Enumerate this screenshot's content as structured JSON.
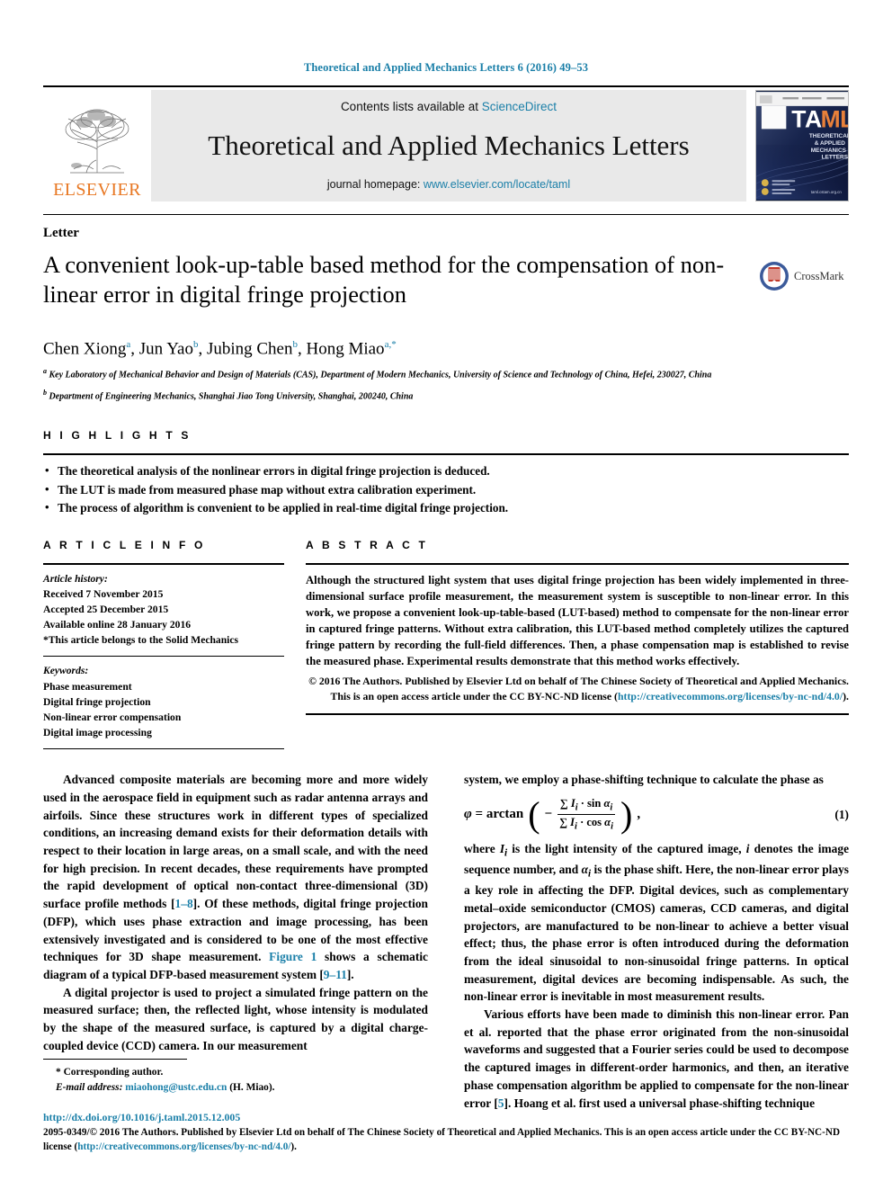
{
  "running_head": "Theoretical and Applied Mechanics Letters 6 (2016) 49–53",
  "masthead": {
    "contents_prefix": "Contents lists available at ",
    "sciencedirect": "ScienceDirect",
    "journal_name": "Theoretical and Applied Mechanics Letters",
    "homepage_prefix": "journal homepage: ",
    "homepage_url": "www.elsevier.com/locate/taml",
    "publisher": "ELSEVIER",
    "cover": {
      "title": "TAML",
      "subtitle_lines": [
        "THEORETICAL",
        "& APPLIED",
        "MECHANICS",
        "LETTERS"
      ],
      "footer_url": "taml.cstam.org.cn"
    }
  },
  "article": {
    "doctype": "Letter",
    "title": "A convenient look-up-table based method for the compensation of non-linear error in digital fringe projection",
    "crossmark_label": "CrossMark",
    "authors_html": "Chen Xiong <sup>a</sup>, Jun Yao <sup>b</sup>, Jubing Chen <sup>b</sup>, Hong Miao <sup>a,*</sup>",
    "affiliations": [
      "Key Laboratory of Mechanical Behavior and Design of Materials (CAS), Department of Modern Mechanics, University of Science and Technology of China, Hefei, 230027, China",
      "Department of Engineering Mechanics, Shanghai Jiao Tong University, Shanghai, 200240, China"
    ],
    "affiliation_marks": [
      "a",
      "b"
    ]
  },
  "highlights": {
    "heading": "H I G H L I G H T S",
    "items": [
      "The theoretical analysis of the nonlinear errors in digital fringe projection is deduced.",
      "The LUT is made from measured phase map without extra calibration experiment.",
      "The process of algorithm is convenient to be applied in real-time digital fringe projection."
    ]
  },
  "article_info": {
    "heading": "A R T I C L E    I N F O",
    "history_label": "Article history:",
    "history": [
      "Received 7 November 2015",
      "Accepted 25 December 2015",
      "Available online 28 January 2016",
      "*This article belongs to the Solid Mechanics"
    ],
    "keywords_label": "Keywords:",
    "keywords": [
      "Phase measurement",
      "Digital fringe projection",
      "Non-linear error compensation",
      "Digital image processing"
    ]
  },
  "abstract": {
    "heading": "A B S T R A C T",
    "text": "Although the structured light system that uses digital fringe projection has been widely implemented in three-dimensional surface profile measurement, the measurement system is susceptible to non-linear error. In this work, we propose a convenient look-up-table-based (LUT-based) method to compensate for the non-linear error in captured fringe patterns. Without extra calibration, this LUT-based method completely utilizes the captured fringe pattern by recording the full-field differences. Then, a phase compensation map is established to revise the measured phase. Experimental results demonstrate that this method works effectively.",
    "copyright": "© 2016 The Authors. Published by Elsevier Ltd on behalf of The Chinese Society of Theoretical and Applied Mechanics. This is an open access article under the CC BY-NC-ND license (",
    "copyright_link": "http://creativecommons.org/licenses/by-nc-nd/4.0/",
    "copyright_tail": ")."
  },
  "body": {
    "left_paragraphs": [
      "Advanced composite materials are becoming more and more widely used in the aerospace field in equipment such as radar antenna arrays and airfoils. Since these structures work in different types of specialized conditions, an increasing demand exists for their deformation details with respect to their location in large areas, on a small scale, and with the need for high precision. In recent decades, these requirements have prompted the rapid development of optical non-contact three-dimensional (3D) surface profile methods [1–8]. Of these methods, digital fringe projection (DFP), which uses phase extraction and image processing, has been extensively investigated and is considered to be one of the most effective techniques for 3D shape measurement. Figure 1 shows a schematic diagram of a typical DFP-based measurement system [9–11].",
      "A digital projector is used to project a simulated fringe pattern on the measured surface; then, the reflected light, whose intensity is modulated by the shape of the measured surface, is captured by a digital charge-coupled device (CCD) camera. In our measurement"
    ],
    "right_intro": "system, we employ a phase-shifting technique to calculate the phase as",
    "equation": {
      "lhs": "φ = arctan",
      "numerator": "∑ I𝑖 · sin α𝑖",
      "denominator": "∑ I𝑖 · cos α𝑖",
      "minus": "−",
      "comma": ",",
      "number": "(1)"
    },
    "right_paragraphs": [
      "where I𝑖 is the light intensity of the captured image, i denotes the image sequence number, and α𝑖 is the phase shift. Here, the non-linear error plays a key role in affecting the DFP. Digital devices, such as complementary metal–oxide semiconductor (CMOS) cameras, CCD cameras, and digital projectors, are manufactured to be non-linear to achieve a better visual effect; thus, the phase error is often introduced during the deformation from the ideal sinusoidal to non-sinusoidal fringe patterns. In optical measurement, digital devices are becoming indispensable. As such, the non-linear error is inevitable in most measurement results.",
      "Various efforts have been made to diminish this non-linear error. Pan et al. reported that the phase error originated from the non-sinusoidal waveforms and suggested that a Fourier series could be used to decompose the captured images in different-order harmonics, and then, an iterative phase compensation algorithm be applied to compensate for the non-linear error [5]. Hoang et al. first used a universal phase-shifting technique"
    ],
    "citation_links": [
      "1–8",
      "9–11",
      "Figure 1",
      "5"
    ]
  },
  "footer": {
    "corresponding_mark": "*",
    "corresponding_label": "Corresponding author.",
    "email_label": "E-mail address:",
    "email": "miaohong@ustc.edu.cn",
    "email_owner": "(H. Miao).",
    "doi": "http://dx.doi.org/10.1016/j.taml.2015.12.005",
    "issn_copyright": "2095-0349/© 2016 The Authors. Published by Elsevier Ltd on behalf of The Chinese Society of Theoretical and Applied Mechanics. This is an open access article under the CC BY-NC-ND license (",
    "issn_link": "http://creativecommons.org/licenses/by-nc-nd/4.0/",
    "issn_tail": ")."
  },
  "colors": {
    "link": "#1a7fa8",
    "elsevier_orange": "#E87722",
    "masthead_bg": "#e9e9e9",
    "cover_navy": "#0d1b3e"
  }
}
